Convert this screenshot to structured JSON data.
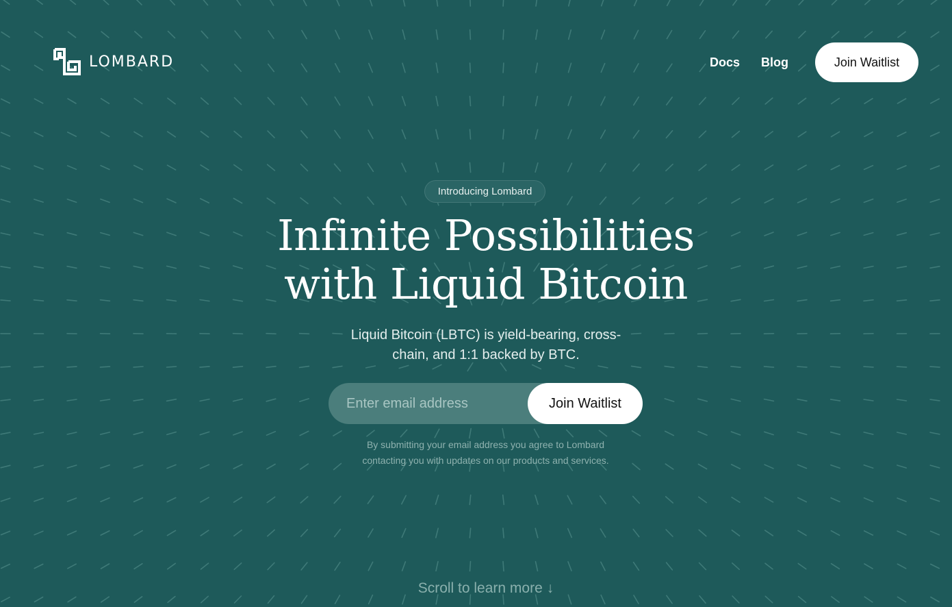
{
  "header": {
    "logo_text": "LOMBARD",
    "nav": {
      "docs_label": "Docs",
      "blog_label": "Blog",
      "join_label": "Join Waitlist"
    }
  },
  "hero": {
    "badge": "Introducing Lombard",
    "headline_line1": "Infinite Possibilities",
    "headline_line2": "with Liquid Bitcoin",
    "subtitle_line1": "Liquid Bitcoin (LBTC) is yield-bearing, cross-",
    "subtitle_line2": "chain, and 1:1 backed by BTC.",
    "form": {
      "email_placeholder": "Enter email address",
      "email_value": "",
      "submit_label": "Join Waitlist"
    },
    "disclaimer_line1": "By submitting your email address you agree to Lombard",
    "disclaimer_line2": "contacting you with updates on our products and services."
  },
  "footer": {
    "scroll_label": "Scroll to learn more",
    "scroll_icon": "arrow-down-icon"
  },
  "colors": {
    "background": "#1e5a5a",
    "pattern": "#3f7a78",
    "button_bg": "#ffffff",
    "input_bg": "#4b7e7c"
  }
}
